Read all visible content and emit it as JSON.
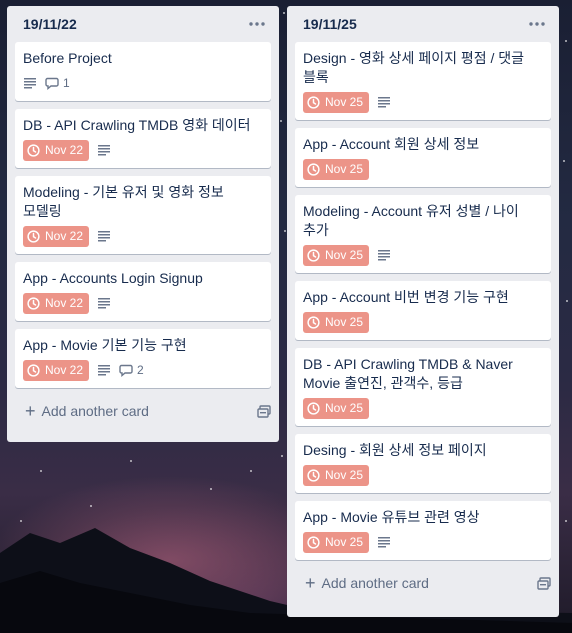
{
  "lists": [
    {
      "title": "19/11/22",
      "add_label": "Add another card",
      "cards": [
        {
          "title": "Before Project",
          "comments": "1"
        },
        {
          "title": "DB - API Crawling TMDB 영화 데이터",
          "due": "Nov 22"
        },
        {
          "title": "Modeling - 기본 유저 및 영화 정보 모델링",
          "due": "Nov 22"
        },
        {
          "title": "App - Accounts Login Signup",
          "due": "Nov 22"
        },
        {
          "title": "App - Movie 기본 기능 구현",
          "due": "Nov 22",
          "comments": "2"
        }
      ]
    },
    {
      "title": "19/11/25",
      "add_label": "Add another card",
      "cards": [
        {
          "title": "Design - 영화 상세 페이지 평점 / 댓글 블록",
          "due": "Nov 25"
        },
        {
          "title": "App - Account 회원 상세 정보",
          "due": "Nov 25"
        },
        {
          "title": "Modeling - Account 유저 성별 / 나이 추가",
          "due": "Nov 25"
        },
        {
          "title": "App - Account 비번 변경 기능 구현",
          "due": "Nov 25"
        },
        {
          "title": "DB - API Crawling TMDB & Naver Movie 출연진, 관객수, 등급",
          "due": "Nov 25"
        },
        {
          "title": "Desing - 회원 상세 정보 페이지",
          "due": "Nov 25"
        },
        {
          "title": "App - Movie 유튜브 관련 영상",
          "due": "Nov 25"
        }
      ]
    }
  ],
  "colors": {
    "due_badge": "#ec9488",
    "list_bg": "#ebecf0",
    "text": "#172b4d",
    "muted": "#5e6c84"
  },
  "icons": {
    "due": "clock-icon",
    "description": "description-icon",
    "comments": "comment-icon",
    "menu": "more-horizontal-icon",
    "add": "plus-icon",
    "template": "card-template-icon"
  }
}
